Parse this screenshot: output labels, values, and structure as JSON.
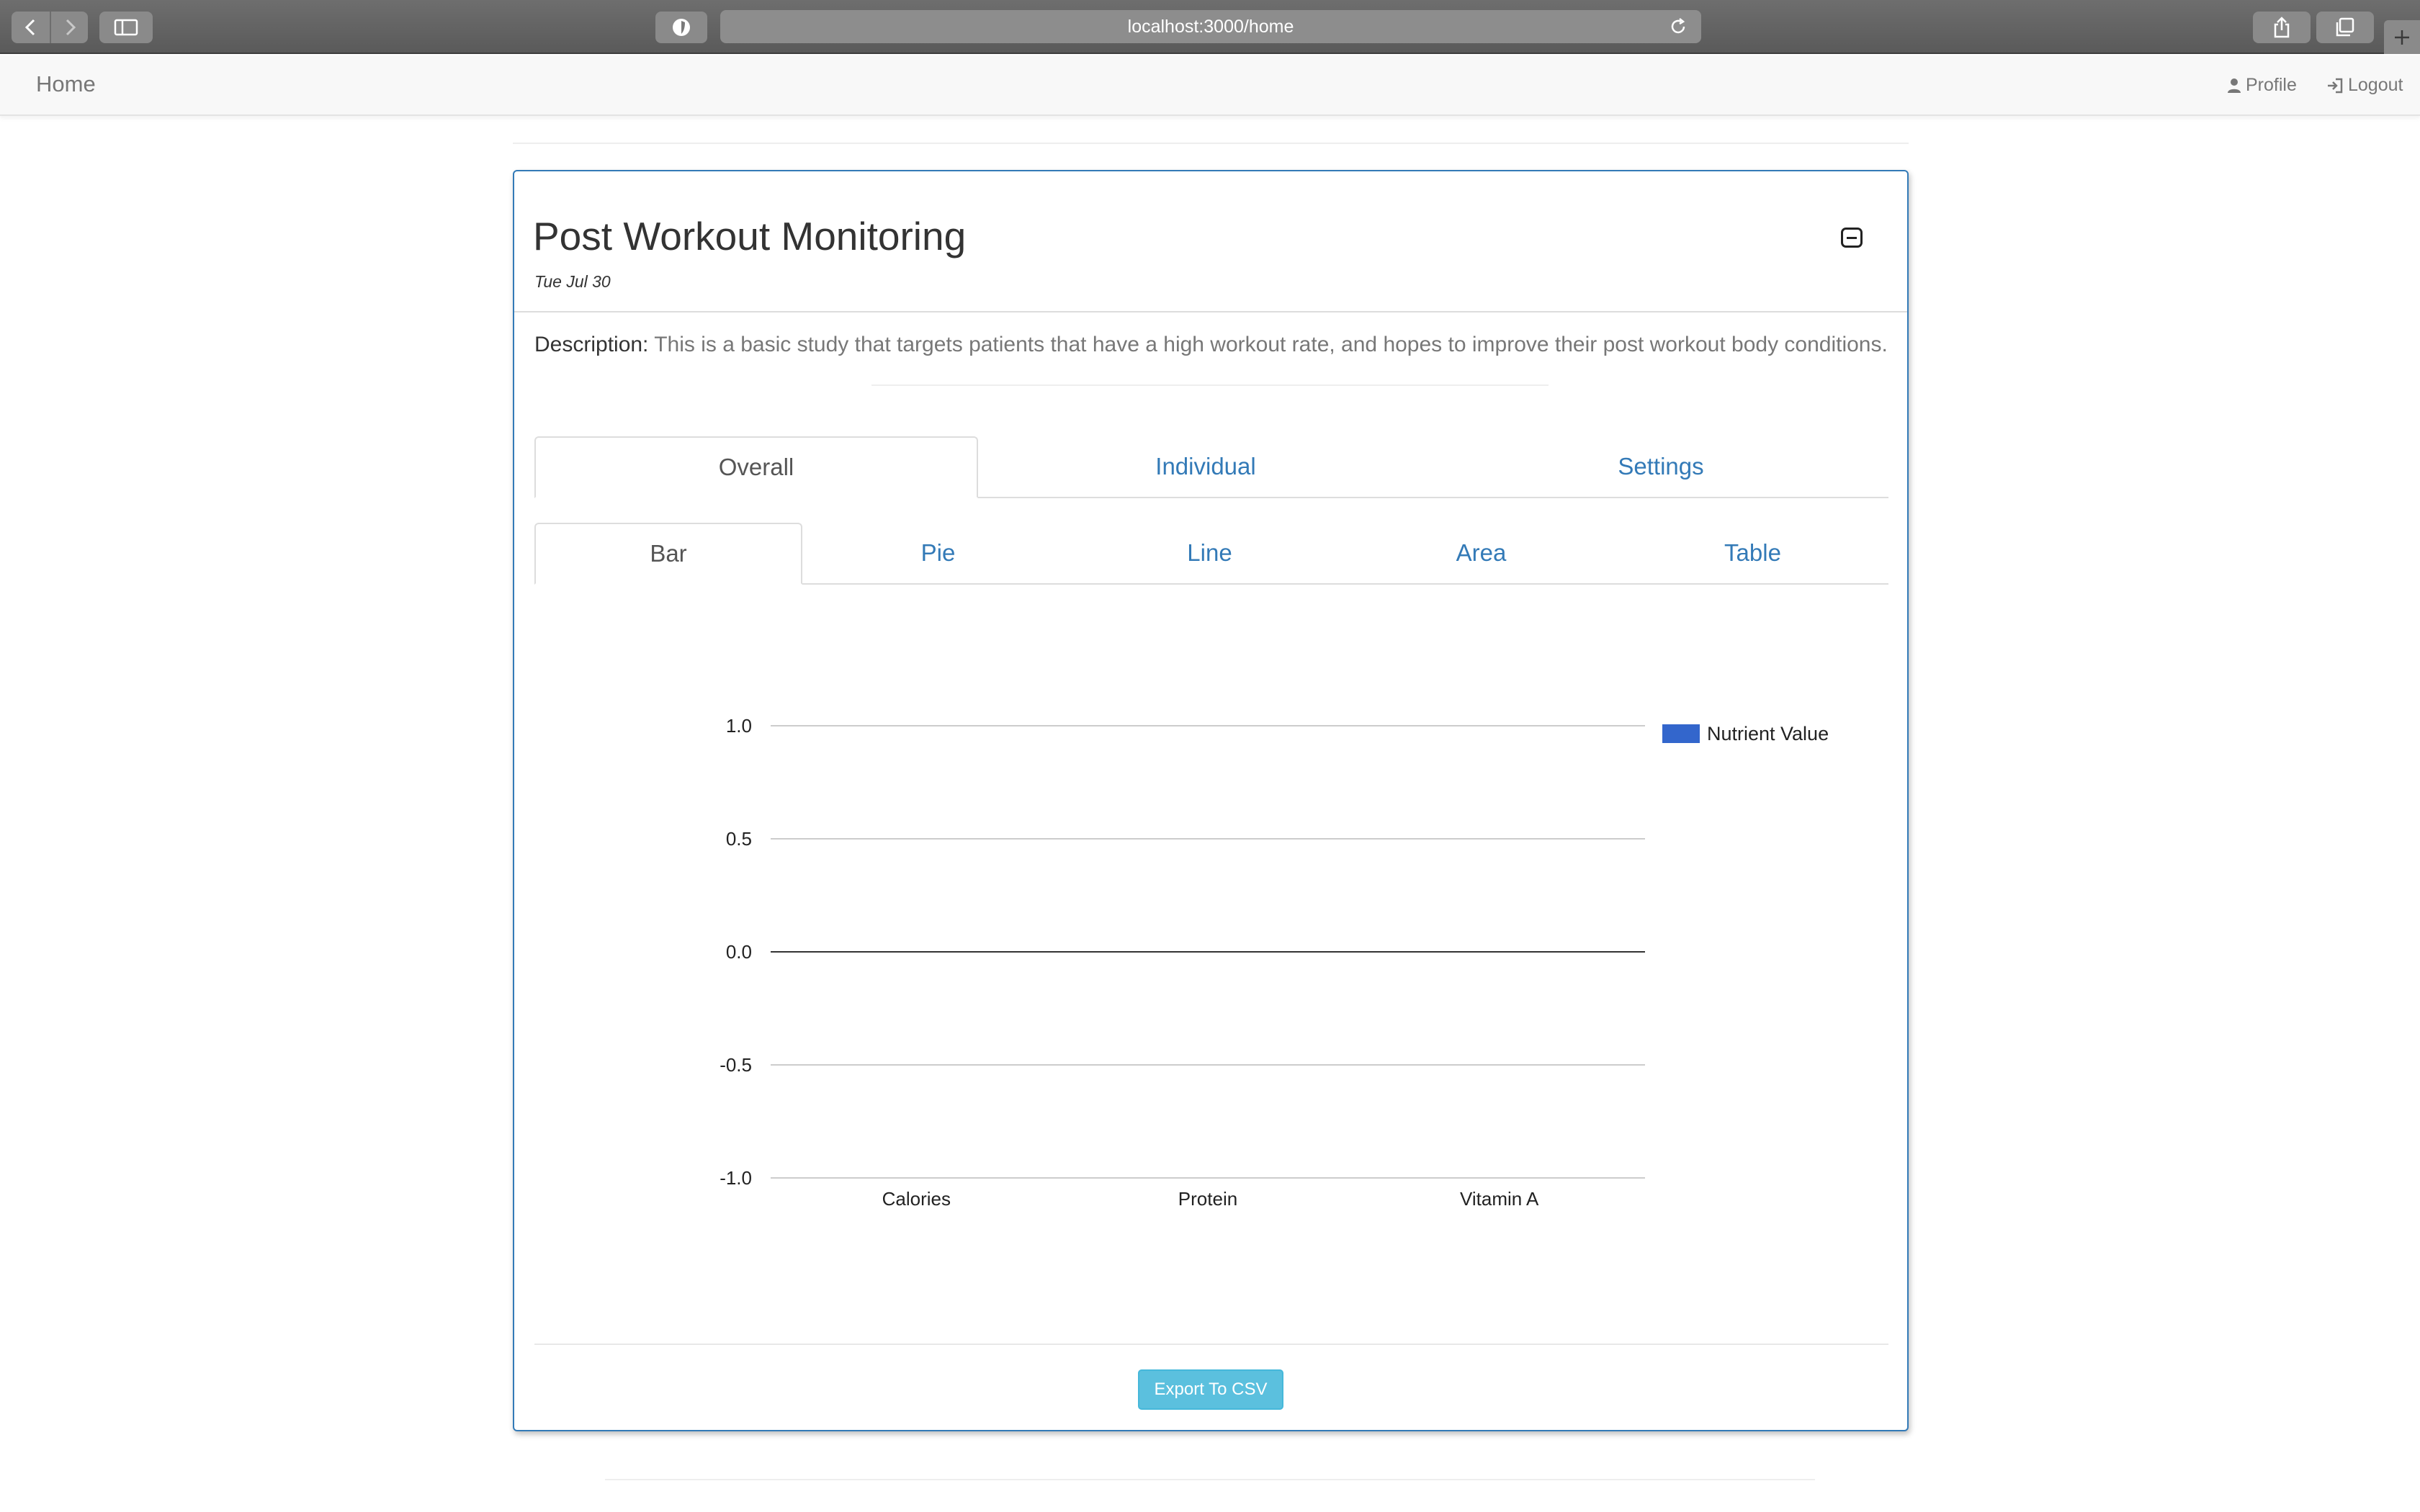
{
  "browser": {
    "url": "localhost:3000/home"
  },
  "navbar": {
    "brand": "Home",
    "profile_label": "Profile",
    "logout_label": "Logout"
  },
  "study": {
    "title": "Post Workout Monitoring",
    "date": "Tue Jul 30",
    "description_label": "Description:",
    "description": "This is a basic study that targets patients that have a high workout rate, and hopes to improve their post workout body conditions."
  },
  "tabs": {
    "main": [
      {
        "label": "Overall",
        "active": true
      },
      {
        "label": "Individual",
        "active": false
      },
      {
        "label": "Settings",
        "active": false
      }
    ],
    "sub": [
      {
        "label": "Bar",
        "active": true
      },
      {
        "label": "Pie",
        "active": false
      },
      {
        "label": "Line",
        "active": false
      },
      {
        "label": "Area",
        "active": false
      },
      {
        "label": "Table",
        "active": false
      }
    ]
  },
  "chart_data": {
    "type": "bar",
    "categories": [
      "Calories",
      "Protein",
      "Vitamin A"
    ],
    "series": [
      {
        "name": "Nutrient Value",
        "values": [
          0,
          0,
          0
        ],
        "color": "#3366cc"
      }
    ],
    "yticks": [
      "1.0",
      "0.5",
      "0.0",
      "-0.5",
      "-1.0"
    ],
    "ylim": [
      -1,
      1
    ],
    "grid": true,
    "legend_position": "right"
  },
  "actions": {
    "export_label": "Export To CSV"
  },
  "colors": {
    "primary": "#337ab7",
    "info": "#5bc0de",
    "series": "#3366cc"
  }
}
